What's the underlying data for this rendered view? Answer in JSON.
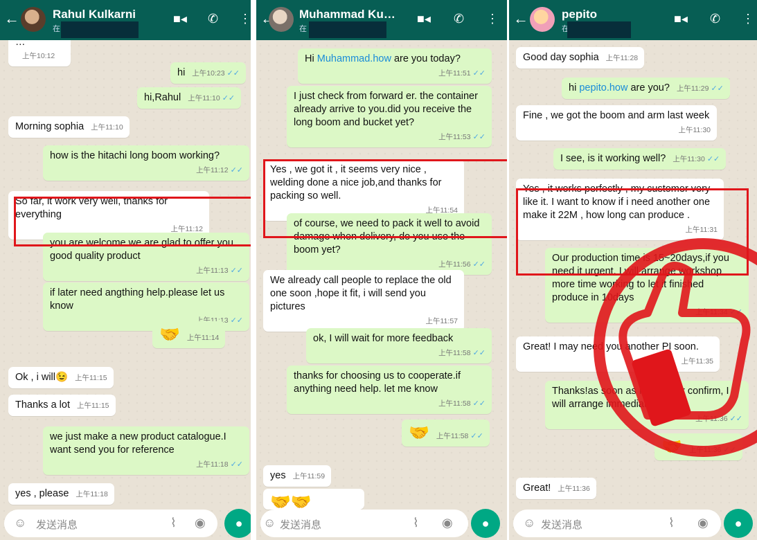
{
  "colors": {
    "header": "#075e54",
    "incoming": "#ffffff",
    "outgoing": "#dcf8c6",
    "highlight": "#e0161b",
    "mic": "#00a884"
  },
  "icons": {
    "back": "arrow-left-icon",
    "video": "video-camera-icon",
    "call": "phone-icon",
    "menu": "more-vert-icon",
    "emoji": "smiley-icon",
    "attach": "paperclip-icon",
    "camera": "camera-icon",
    "mic": "microphone-icon",
    "thumbs": "thumbs-up-stamp-icon"
  },
  "chats": [
    {
      "name": "Rahul Kulkarni",
      "sub": "在",
      "placeholder": "发送消息",
      "messages": [
        {
          "text": "…",
          "time": "上午10:12"
        },
        {
          "text": "hi",
          "time": "上午10:23"
        },
        {
          "text": "hi,Rahul",
          "time": "上午11:10"
        },
        {
          "text": "Morning sophia",
          "time": "上午11:10"
        },
        {
          "text": "how is the hitachi long boom working?",
          "time": "上午11:12"
        },
        {
          "text": "So far, it work very well, thanks for everything",
          "time": "上午11:12"
        },
        {
          "text": "you are welcome.we are glad to offer you good quality product",
          "time": "上午11:13"
        },
        {
          "text": "if later need angthing help.please let us know",
          "time": "上午11:13"
        },
        {
          "text": "🤝",
          "time": "上午11:14"
        },
        {
          "text": "Ok , i will😉",
          "time": "上午11:15"
        },
        {
          "text": "Thanks a lot",
          "time": "上午11:15"
        },
        {
          "text": "we just make a new product catalogue.I want send you for reference",
          "time": "上午11:18"
        },
        {
          "text": "yes , please",
          "time": "上午11:18"
        }
      ]
    },
    {
      "name": "Muhammad Ku…",
      "sub": "在",
      "placeholder": "发送消息",
      "messages": [
        {
          "pre": "Hi ",
          "link": "Muhammad.how",
          "post": " are you today?",
          "time": "上午11:51"
        },
        {
          "text": "I just check from forward er. the container already arrive to you.did you receive the long boom and bucket yet?",
          "time": "上午11:53"
        },
        {
          "text": "Yes , we got it , it seems very nice , welding done a nice job,and thanks for packing so well.",
          "time": "上午11:54"
        },
        {
          "text": "of course, we need to pack it well to avoid damage when delivery, do you use the boom yet?",
          "time": "上午11:56"
        },
        {
          "text": "We already call people to replace the old one soon ,hope it fit, i will send you pictures",
          "time": "上午11:57"
        },
        {
          "text": "ok, I will wait for more feedback",
          "time": "上午11:58"
        },
        {
          "text": "thanks for choosing us to cooperate.if anything need help. let me know",
          "time": "上午11:58"
        },
        {
          "text": "🤝",
          "time": "上午11:58"
        },
        {
          "text": "yes",
          "time": "上午11:59"
        },
        {
          "text": "🤝🤝",
          "time": ""
        }
      ]
    },
    {
      "name": "pepito",
      "sub": "在",
      "placeholder": "发送消息",
      "messages": [
        {
          "text": "Good day sophia",
          "time": "上午11:28"
        },
        {
          "pre": "hi ",
          "link": "pepito.how",
          "post": " are you?",
          "time": "上午11:29"
        },
        {
          "text": "Fine , we got the boom and arm last week",
          "time": "上午11:30"
        },
        {
          "text": "I see, is it working well?",
          "time": "上午11:30"
        },
        {
          "text": "Yes , it works perfectly , my customer very like it. I want to know if i need another one make it 22M , how long can produce .",
          "time": "上午11:31"
        },
        {
          "text": "Our production time is 15~20days,if you need it urgent, I will arrange workshop more time working to let it finished produce in 10days",
          "time": "上午11:34"
        },
        {
          "text": "Great! I may need you another PI soon.",
          "time": "上午11:35"
        },
        {
          "text": "Thanks!as soon as I get order confirm, I will arrange immediately",
          "time": "上午11:36"
        },
        {
          "text": "🤝",
          "time": "上午11:36"
        },
        {
          "text": "Great!",
          "time": "上午11:36"
        }
      ]
    }
  ]
}
